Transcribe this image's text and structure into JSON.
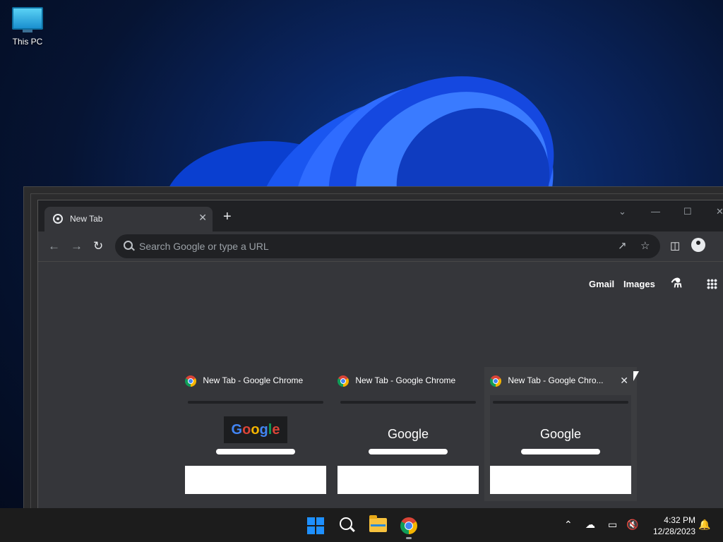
{
  "desktop": {
    "icon_label": "This PC"
  },
  "browser": {
    "tab_title": "New Tab",
    "tab_close": "✕",
    "new_tab": "+",
    "omnibox_placeholder": "Search Google or type a URL",
    "links": {
      "gmail": "Gmail",
      "images": "Images"
    }
  },
  "task_view": [
    {
      "caption": "New Tab - Google Chrome",
      "logo": "Google",
      "doodle": true
    },
    {
      "caption": "New Tab - Google Chrome",
      "logo": "Google",
      "doodle": false
    },
    {
      "caption": "New Tab - Google Chro...",
      "logo": "Google",
      "doodle": false,
      "close": "✕"
    }
  ],
  "taskbar": {
    "time": "4:32 PM",
    "date": "12/28/2023"
  },
  "colors": {
    "accent": "#1e90ff",
    "chrome_dark": "#35363a",
    "taskbar": "#1c1c1c"
  }
}
